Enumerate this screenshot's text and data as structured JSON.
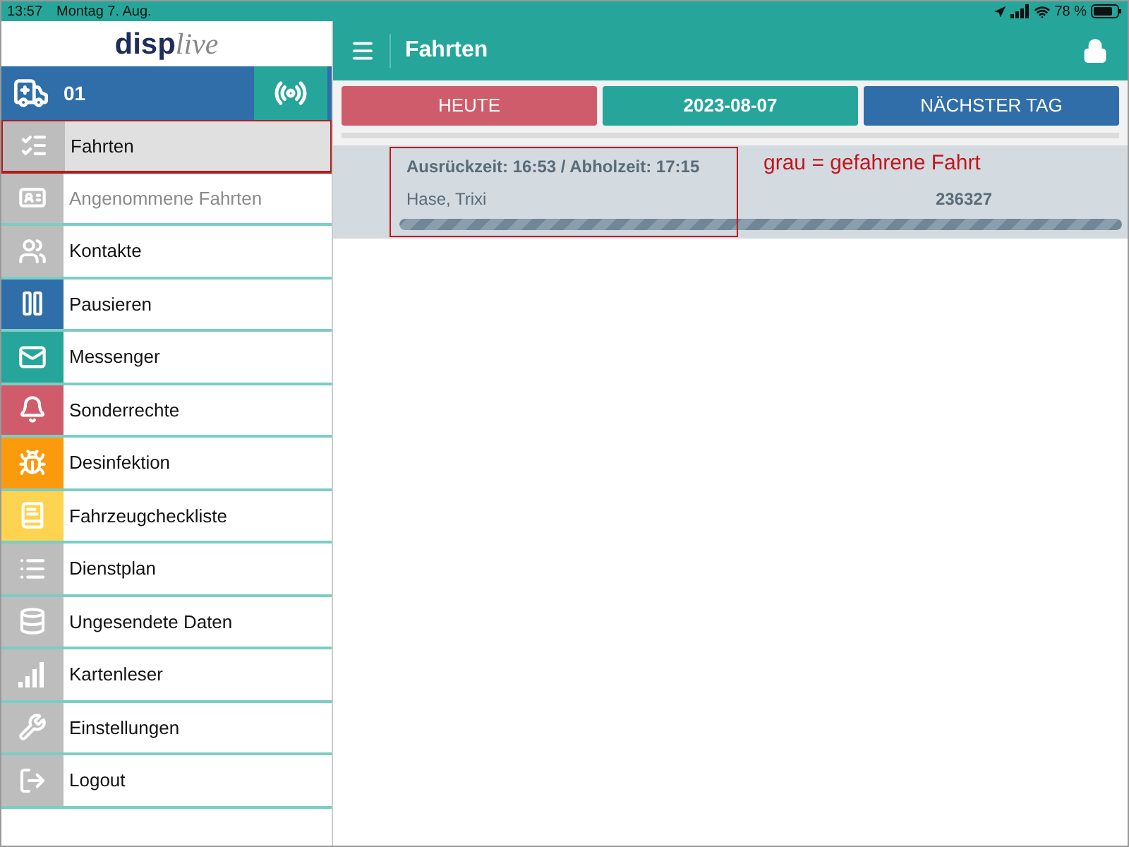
{
  "status_bar": {
    "time": "13:57",
    "date": "Montag 7. Aug.",
    "battery": "78 %"
  },
  "sidebar": {
    "logo": {
      "left": "disp",
      "right": "live"
    },
    "vehicle": {
      "label": "01"
    },
    "items": [
      {
        "label": "Fahrten",
        "color": "#bdbdbd",
        "selected": true,
        "disabled": false
      },
      {
        "label": "Angenommene Fahrten",
        "color": "#bdbdbd",
        "selected": false,
        "disabled": true
      },
      {
        "label": "Kontakte",
        "color": "#bdbdbd",
        "selected": false,
        "disabled": false
      },
      {
        "label": "Pausieren",
        "color": "#2f6ea8",
        "selected": false,
        "disabled": false
      },
      {
        "label": "Messenger",
        "color": "#26a69a",
        "selected": false,
        "disabled": false
      },
      {
        "label": "Sonderrechte",
        "color": "#d05c6b",
        "selected": false,
        "disabled": false
      },
      {
        "label": "Desinfektion",
        "color": "#fb9a0c",
        "selected": false,
        "disabled": false
      },
      {
        "label": "Fahrzeugcheckliste",
        "color": "#fdd34f",
        "selected": false,
        "disabled": false
      },
      {
        "label": "Dienstplan",
        "color": "#bdbdbd",
        "selected": false,
        "disabled": false
      },
      {
        "label": "Ungesendete Daten",
        "color": "#bdbdbd",
        "selected": false,
        "disabled": false
      },
      {
        "label": "Kartenleser",
        "color": "#bdbdbd",
        "selected": false,
        "disabled": false
      },
      {
        "label": "Einstellungen",
        "color": "#bdbdbd",
        "selected": false,
        "disabled": false
      },
      {
        "label": "Logout",
        "color": "#bdbdbd",
        "selected": false,
        "disabled": false
      }
    ]
  },
  "header": {
    "title": "Fahrten"
  },
  "day_buttons": [
    {
      "label": "HEUTE",
      "color": "#cf5c6b"
    },
    {
      "label": "2023-08-07",
      "color": "#26a69a"
    },
    {
      "label": "NÄCHSTER TAG",
      "color": "#2f6ea8"
    }
  ],
  "trips": [
    {
      "times": "Ausrückzeit: 16:53 / Abholzeit: 17:15",
      "name": "Hase, Trixi",
      "number": "236327",
      "level": 1
    }
  ],
  "annotation": {
    "text": "grau = gefahrene Fahrt"
  }
}
